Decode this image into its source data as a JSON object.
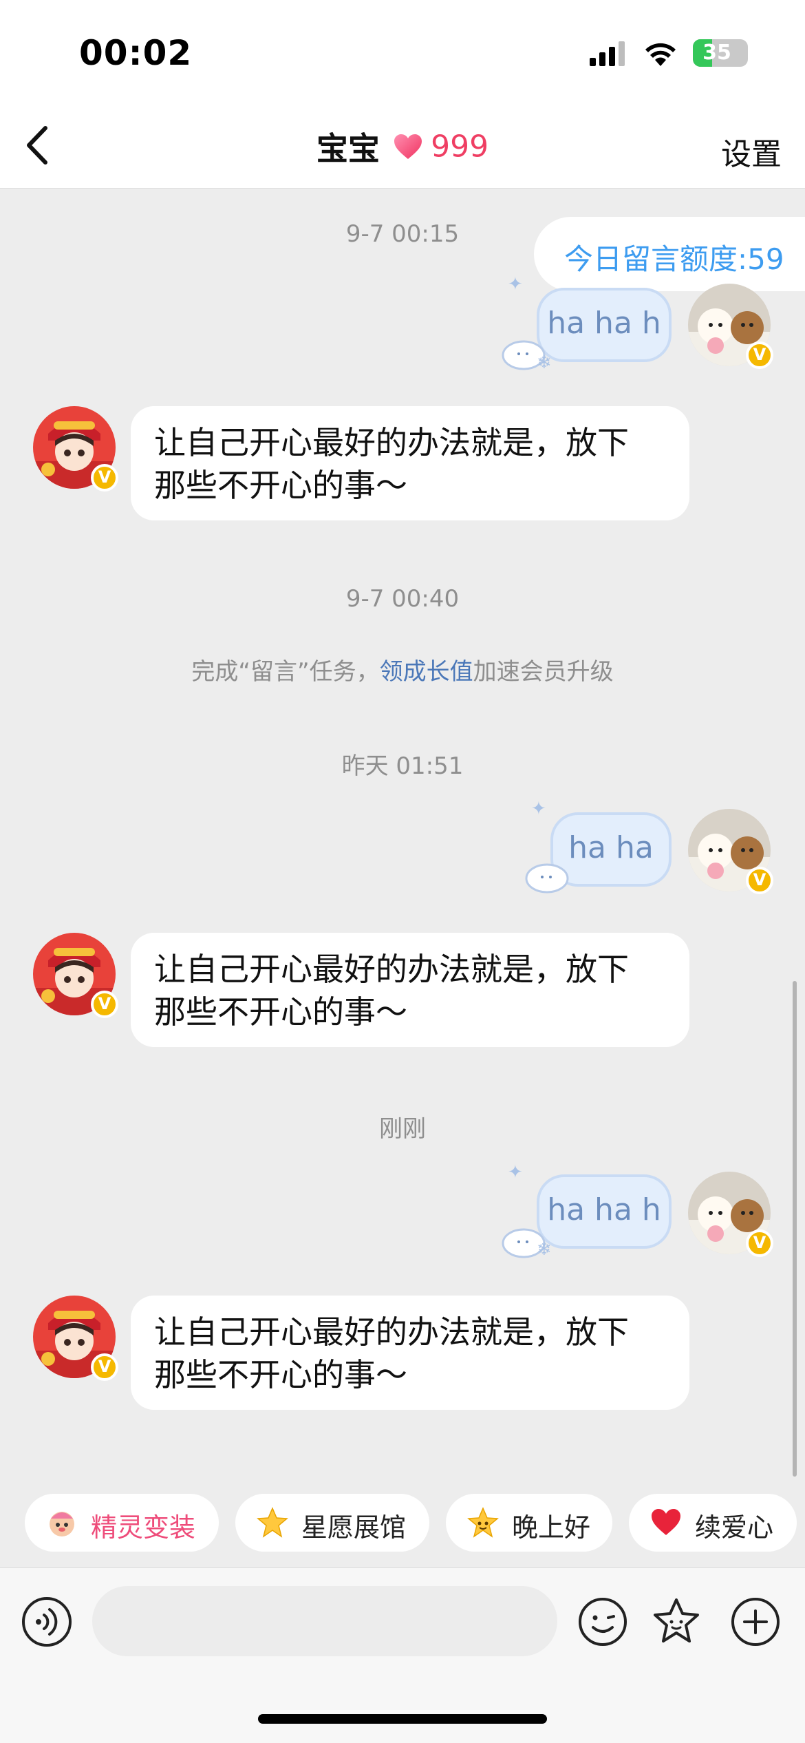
{
  "status_bar": {
    "time": "00:02",
    "battery": "35",
    "battery_level": 0.35
  },
  "nav": {
    "title": "宝宝",
    "heart_count": "999",
    "settings_label": "设置"
  },
  "quota": {
    "text": "今日留言额度:59"
  },
  "timestamps": [
    "9-7 00:15",
    "9-7 00:40",
    "昨天 01:51",
    "刚刚"
  ],
  "system_message": {
    "prefix": "完成“留言”任务，",
    "link": "领成长值",
    "suffix": "加速会员升级"
  },
  "messages": [
    {
      "from": "me",
      "text": "ha ha h"
    },
    {
      "from": "them",
      "line1": "让自己开心最好的办法就是，放下",
      "line2": "那些不开心的事～"
    },
    {
      "from": "me",
      "text": "ha ha"
    },
    {
      "from": "them",
      "line1": "让自己开心最好的办法就是，放下",
      "line2": "那些不开心的事～"
    },
    {
      "from": "me",
      "text": "ha ha h"
    },
    {
      "from": "them",
      "line1": "让自己开心最好的办法就是，放下",
      "line2": "那些不开心的事～"
    }
  ],
  "quick_actions": [
    {
      "label": "精灵变装",
      "icon": "sprite-face-icon"
    },
    {
      "label": "星愿展馆",
      "icon": "star-icon"
    },
    {
      "label": "晚上好",
      "icon": "star-face-icon"
    },
    {
      "label": "续爱心",
      "icon": "heart-icon"
    }
  ],
  "input_bar": {
    "placeholder": ""
  },
  "colors": {
    "accent_blue": "#3d9cf0",
    "heart_pink": "#ef3e63",
    "link_blue": "#4a77b8",
    "chat_bg": "#ededed"
  },
  "avatar_badge": "V"
}
